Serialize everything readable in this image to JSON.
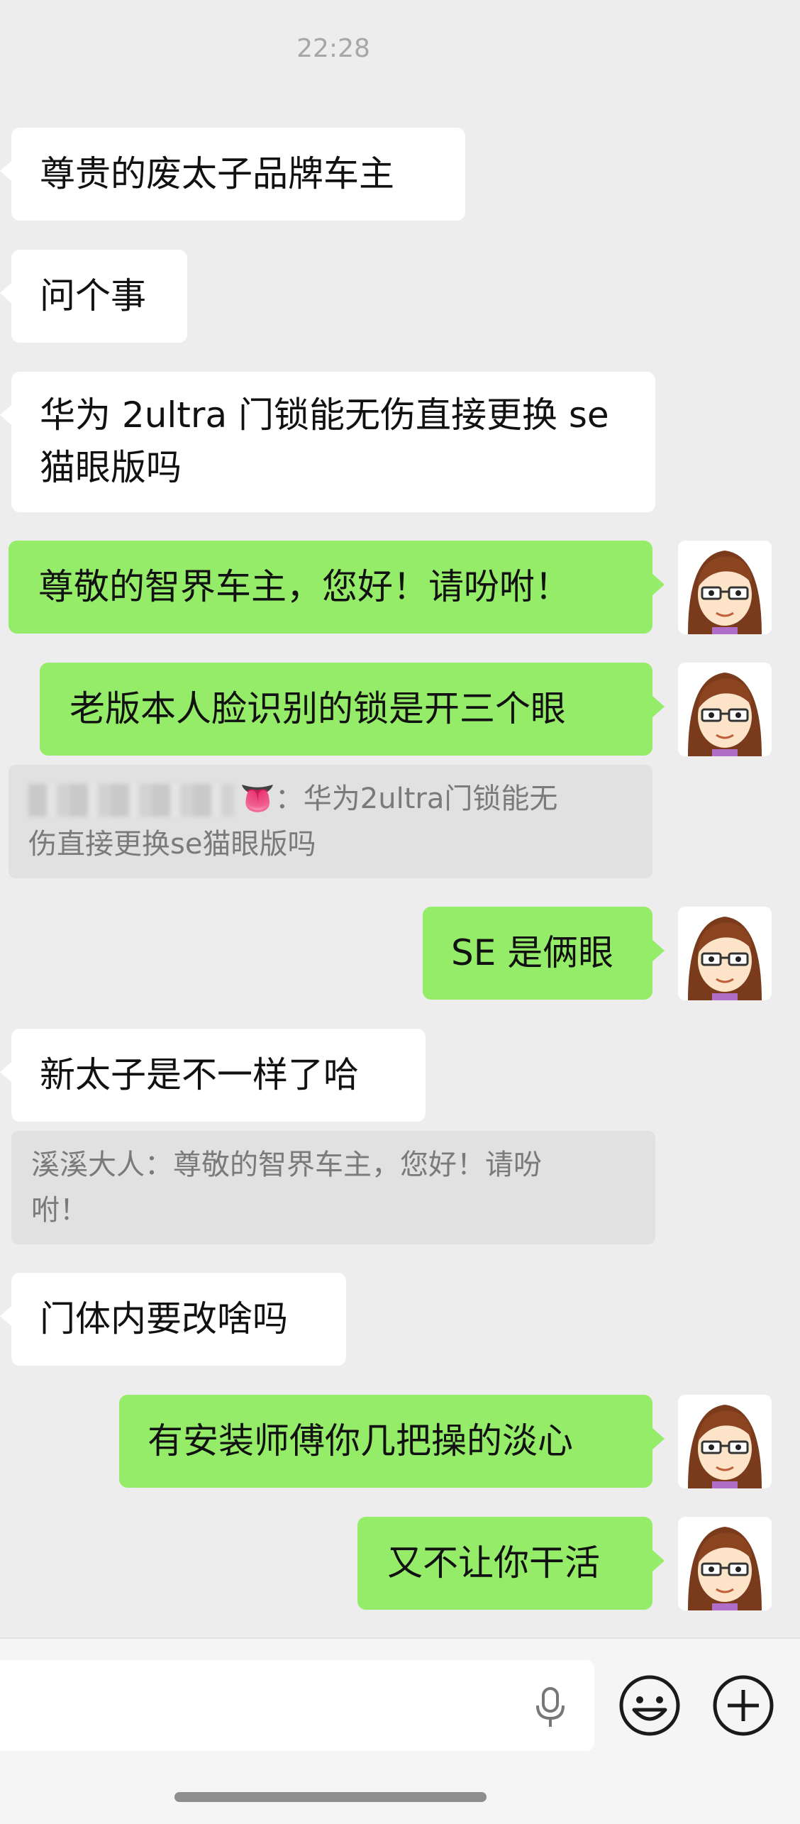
{
  "header": {
    "time": "22:28"
  },
  "messages": [
    {
      "side": "left",
      "text": "尊贵的废太子品牌车主"
    },
    {
      "side": "left",
      "text": "问个事"
    },
    {
      "side": "left",
      "lines": [
        "华为 2ultra 门锁能无伤直接更换 se",
        "猫眼版吗"
      ]
    },
    {
      "side": "right",
      "text": "尊敬的智界车主，您好！请吩咐！",
      "avatar": "avatar-icon"
    },
    {
      "side": "right",
      "text": "老版本人脸识别的锁是开三个眼",
      "avatar": "avatar-icon"
    },
    {
      "side": "right",
      "text": "SE 是俩眼",
      "avatar": "avatar-icon"
    },
    {
      "side": "left",
      "text": "新太子是不一样了哈"
    },
    {
      "side": "left",
      "text": "门体内要改啥吗"
    },
    {
      "side": "right",
      "text": "有安装师傅你几把操的淡心",
      "avatar": "avatar-icon"
    },
    {
      "side": "right",
      "text": "又不让你干活",
      "avatar": "avatar-icon"
    }
  ],
  "quotes": [
    {
      "emoji": "👅",
      "lines": [
        "：华为2ultra门锁能无",
        "伤直接更换se猫眼版吗"
      ]
    },
    {
      "lines": [
        "溪溪大人：尊敬的智界车主，您好！请吩",
        "咐！"
      ]
    }
  ],
  "input_bar": {
    "voice_icon": "microphone-icon",
    "emoji_icon": "smiley-icon",
    "more_icon": "plus-circle-icon"
  },
  "colors": {
    "background": "#ededed",
    "sent_bubble": "#95ec69",
    "received_bubble": "#ffffff",
    "quote_bg": "#e1e1e1"
  }
}
